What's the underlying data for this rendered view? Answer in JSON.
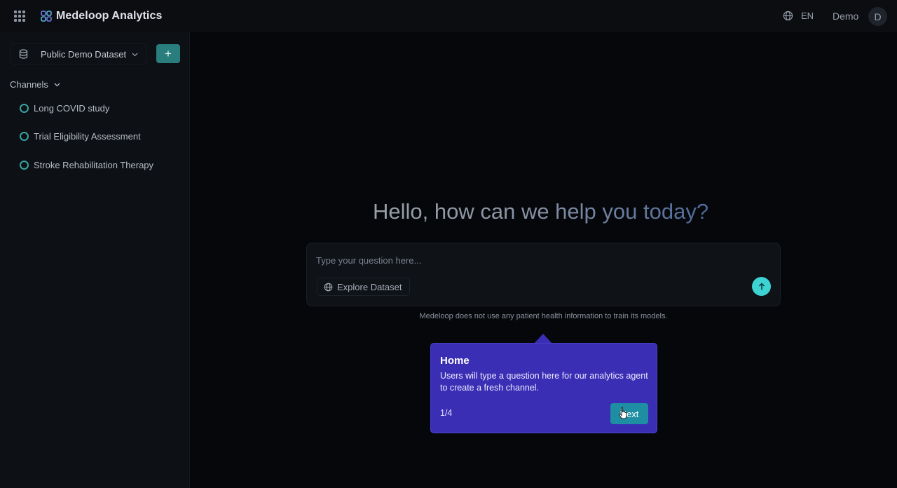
{
  "header": {
    "app_name": "Medeloop Analytics",
    "language": "EN",
    "user_name": "Demo",
    "avatar_initial": "D",
    "icons": [
      "apps-grid-icon",
      "medeloop-logo",
      "globe-icon"
    ]
  },
  "sidebar": {
    "dataset": "Public Demo Dataset",
    "add_label": "+",
    "channels_heading": "Channels",
    "channels": [
      {
        "label": "Long COVID study"
      },
      {
        "label": "Trial Eligibility Assessment"
      },
      {
        "label": "Stroke Rehabilitation Therapy"
      }
    ]
  },
  "main": {
    "greeting": "Hello, how can we help you today?",
    "input_placeholder": "Type your question here...",
    "input_value": "",
    "explore_label": "Explore Dataset",
    "disclaimer": "Medeloop does not use any patient health information to train its models."
  },
  "tour": {
    "title": "Home",
    "body": "Users will type a question here for our analytics agent to create a fresh channel.",
    "step": "1/4",
    "next_label": "Next"
  },
  "colors": {
    "accent_teal": "#2a7d7d",
    "send_cyan": "#3dd3d3",
    "tour_purple": "#3a2fb4",
    "tour_button": "#1e8fa3"
  }
}
